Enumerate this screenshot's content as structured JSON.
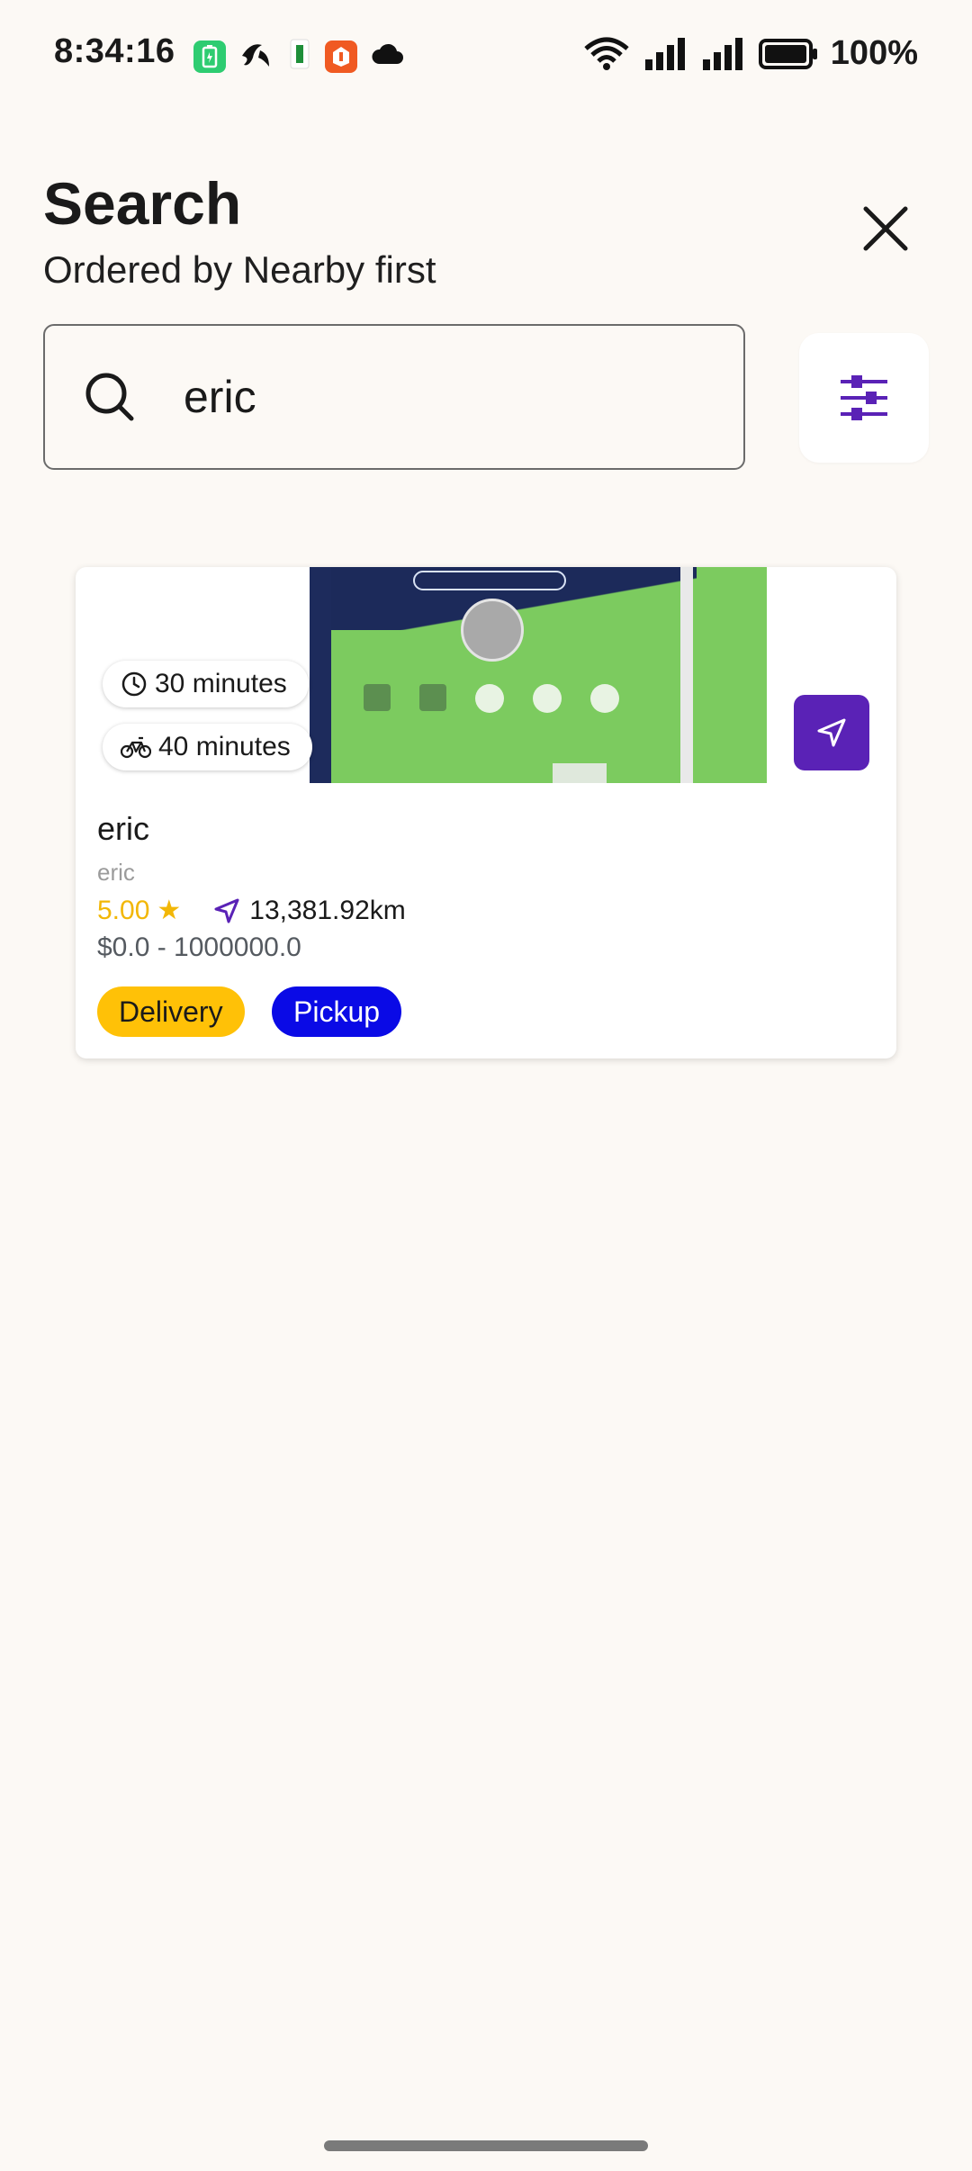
{
  "status_bar": {
    "time": "8:34:16",
    "battery": "100%",
    "app_icons": [
      "battery-saver-icon",
      "telenor-icon",
      "sim-app-icon",
      "orange-app-icon",
      "cloud-icon"
    ]
  },
  "header": {
    "title": "Search",
    "subtitle": "Ordered by Nearby first",
    "close_icon": "close-icon"
  },
  "search": {
    "value": "eric",
    "filter_icon": "sliders-icon"
  },
  "results": [
    {
      "name": "eric",
      "subtitle": "eric",
      "rating": "5.00",
      "distance": "13,381.92km",
      "price_range": "$0.0 - 1000000.0",
      "delivery_time": "30 minutes",
      "pickup_time": "40 minutes",
      "tags": [
        "Delivery",
        "Pickup"
      ]
    }
  ],
  "colors": {
    "accent": "#5a22b6",
    "rating": "#f2b707",
    "delivery_tag": "#ffc107",
    "pickup_tag": "#0a0ae6",
    "background": "#fcf9f5"
  }
}
